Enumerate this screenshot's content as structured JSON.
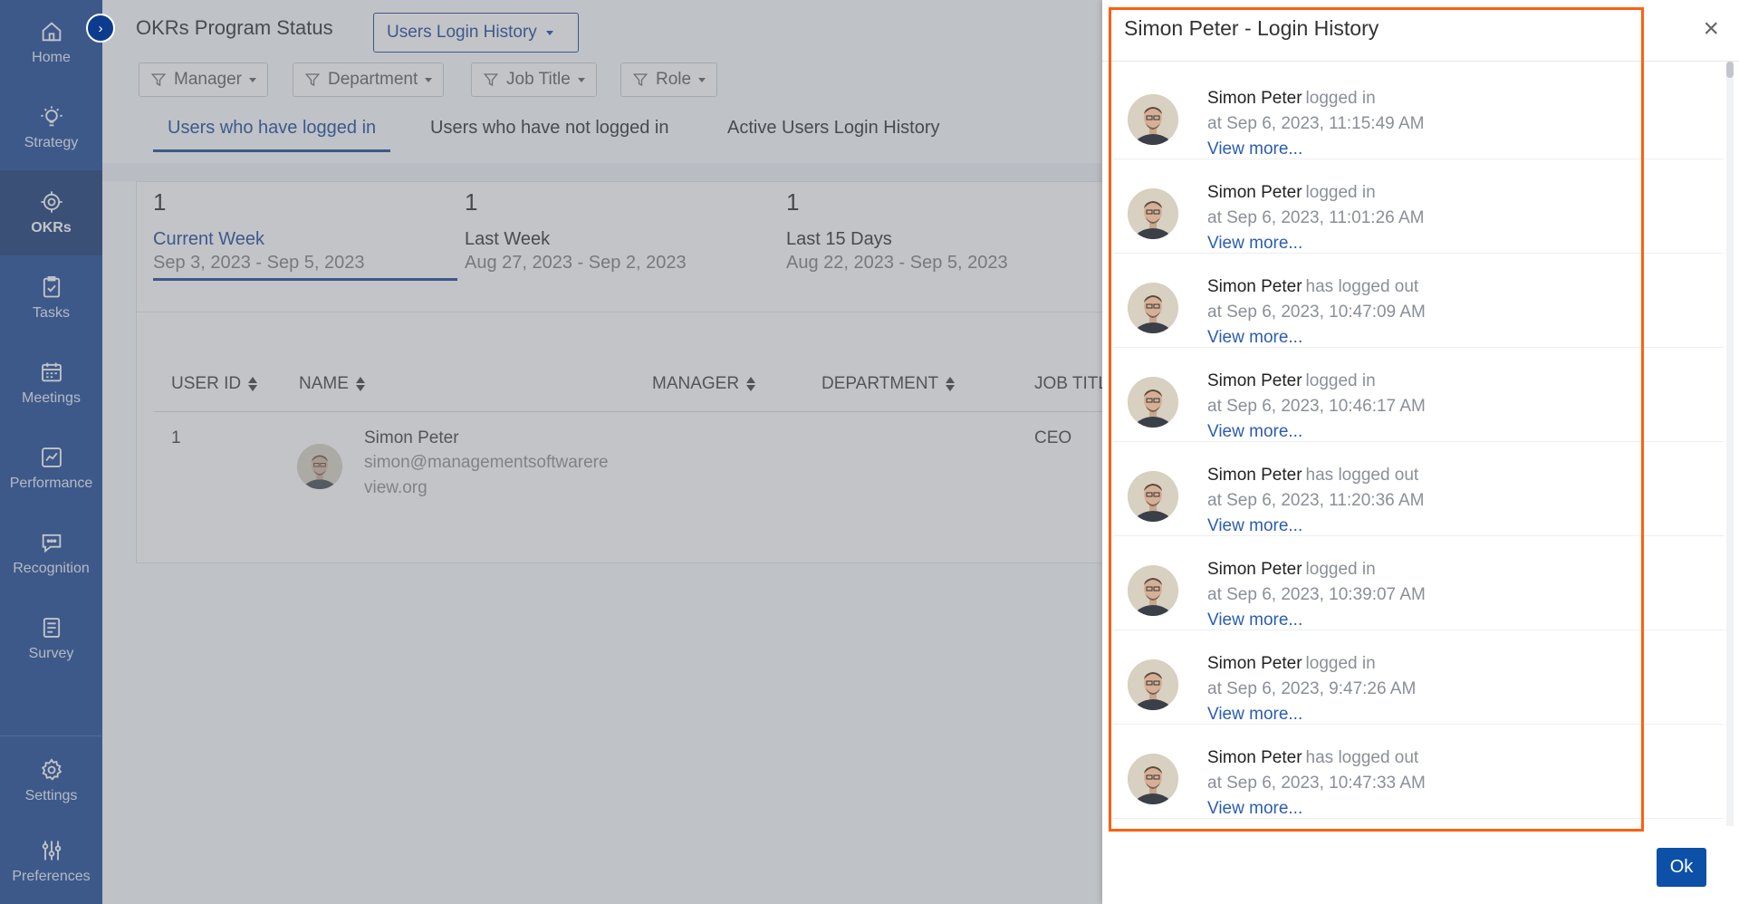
{
  "sidebar": {
    "items": [
      {
        "label": "Home",
        "icon": "home-icon"
      },
      {
        "label": "Strategy",
        "icon": "lightbulb-icon"
      },
      {
        "label": "OKRs",
        "icon": "target-icon"
      },
      {
        "label": "Tasks",
        "icon": "clipboard-check-icon"
      },
      {
        "label": "Meetings",
        "icon": "calendar-icon"
      },
      {
        "label": "Performance",
        "icon": "chart-icon"
      },
      {
        "label": "Recognition",
        "icon": "chat-bubble-icon"
      },
      {
        "label": "Survey",
        "icon": "survey-list-icon"
      },
      {
        "label": "Settings",
        "icon": "gear-icon"
      },
      {
        "label": "Preferences",
        "icon": "sliders-icon"
      }
    ],
    "active": "OKRs"
  },
  "header": {
    "title": "OKRs Program Status",
    "view_dropdown": "Users Login History"
  },
  "filters": [
    "Manager",
    "Department",
    "Job Title",
    "Role"
  ],
  "tabs": [
    "Users who have logged in",
    "Users who have not logged in",
    "Active Users Login History"
  ],
  "stats": [
    {
      "count": "1",
      "label": "Current Week",
      "range": "Sep 3, 2023 - Sep 5, 2023"
    },
    {
      "count": "1",
      "label": "Last Week",
      "range": "Aug 27, 2023 - Sep 2, 2023"
    },
    {
      "count": "1",
      "label": "Last 15 Days",
      "range": "Aug 22, 2023 - Sep 5, 2023"
    }
  ],
  "table": {
    "columns": [
      "USER ID",
      "NAME",
      "MANAGER",
      "DEPARTMENT",
      "JOB TITL"
    ],
    "rows": [
      {
        "user_id": "1",
        "name": "Simon Peter",
        "email_line1": "simon@managementsoftwarere",
        "email_line2": "view.org",
        "manager": "",
        "department": "",
        "job_title": "CEO"
      }
    ]
  },
  "drawer": {
    "title": "Simon Peter - Login History",
    "close": "×",
    "entries": [
      {
        "name": "Simon Peter",
        "action": "logged in",
        "when": "at Sep 6, 2023, 11:15:49 AM",
        "more": "View more..."
      },
      {
        "name": "Simon Peter",
        "action": "logged in",
        "when": "at Sep 6, 2023, 11:01:26 AM",
        "more": "View more..."
      },
      {
        "name": "Simon Peter",
        "action": "has logged out",
        "when": "at Sep 6, 2023, 10:47:09 AM",
        "more": "View more..."
      },
      {
        "name": "Simon Peter",
        "action": "logged in",
        "when": "at Sep 6, 2023, 10:46:17 AM",
        "more": "View more..."
      },
      {
        "name": "Simon Peter",
        "action": "has logged out",
        "when": "at Sep 6, 2023, 11:20:36 AM",
        "more": "View more..."
      },
      {
        "name": "Simon Peter",
        "action": "logged in",
        "when": "at Sep 6, 2023, 10:39:07 AM",
        "more": "View more..."
      },
      {
        "name": "Simon Peter",
        "action": "logged in",
        "when": "at Sep 6, 2023, 9:47:26 AM",
        "more": "View more..."
      },
      {
        "name": "Simon Peter",
        "action": "has logged out",
        "when": "at Sep 6, 2023, 10:47:33 AM",
        "more": "View more..."
      }
    ],
    "ok_label": "Ok"
  },
  "colors": {
    "sidebar": "#0d3c8e",
    "accent": "#0d3c8e",
    "link": "#2a5db0",
    "highlight_border": "#ff5f0f"
  }
}
